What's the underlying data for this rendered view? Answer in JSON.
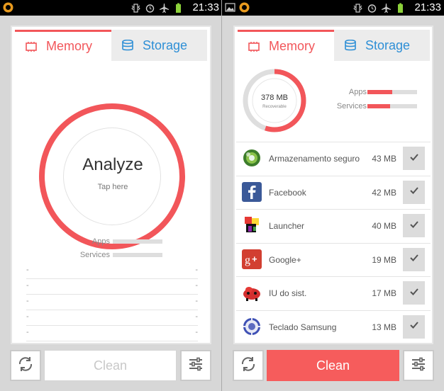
{
  "status_bar": {
    "time": "21:33"
  },
  "tabs": {
    "memory": "Memory",
    "storage": "Storage"
  },
  "analyze": {
    "title": "Analyze",
    "subtitle": "Tap here"
  },
  "legend": {
    "apps": "Apps",
    "services": "Services",
    "apps_ratio": 0.5,
    "services_ratio": 0.45
  },
  "placeholder_rows": [
    {
      "left": "-",
      "right": "-"
    },
    {
      "left": "-",
      "right": "-"
    },
    {
      "left": "-",
      "right": "-"
    },
    {
      "left": "-",
      "right": "-"
    },
    {
      "left": "-",
      "right": "-"
    }
  ],
  "summary": {
    "recoverable_amount": "378 MB",
    "recoverable_label": "Recoverable",
    "ring_fraction": 0.55
  },
  "apps": [
    {
      "name": "Armazenamento seguro",
      "size": "43 MB",
      "icon": "secure-storage-icon"
    },
    {
      "name": "Facebook",
      "size": "42 MB",
      "icon": "facebook-icon"
    },
    {
      "name": "Launcher",
      "size": "40 MB",
      "icon": "launcher-icon"
    },
    {
      "name": "Google+",
      "size": "19 MB",
      "icon": "google-plus-icon"
    },
    {
      "name": "IU do sist.",
      "size": "17 MB",
      "icon": "system-ui-icon"
    },
    {
      "name": "Teclado Samsung",
      "size": "13 MB",
      "icon": "samsung-keyboard-icon"
    }
  ],
  "bottom_bar": {
    "clean_label": "Clean"
  },
  "colors": {
    "accent": "#f2565a",
    "storage_blue": "#2e8fd6",
    "clean_active": "#f65c5c"
  }
}
